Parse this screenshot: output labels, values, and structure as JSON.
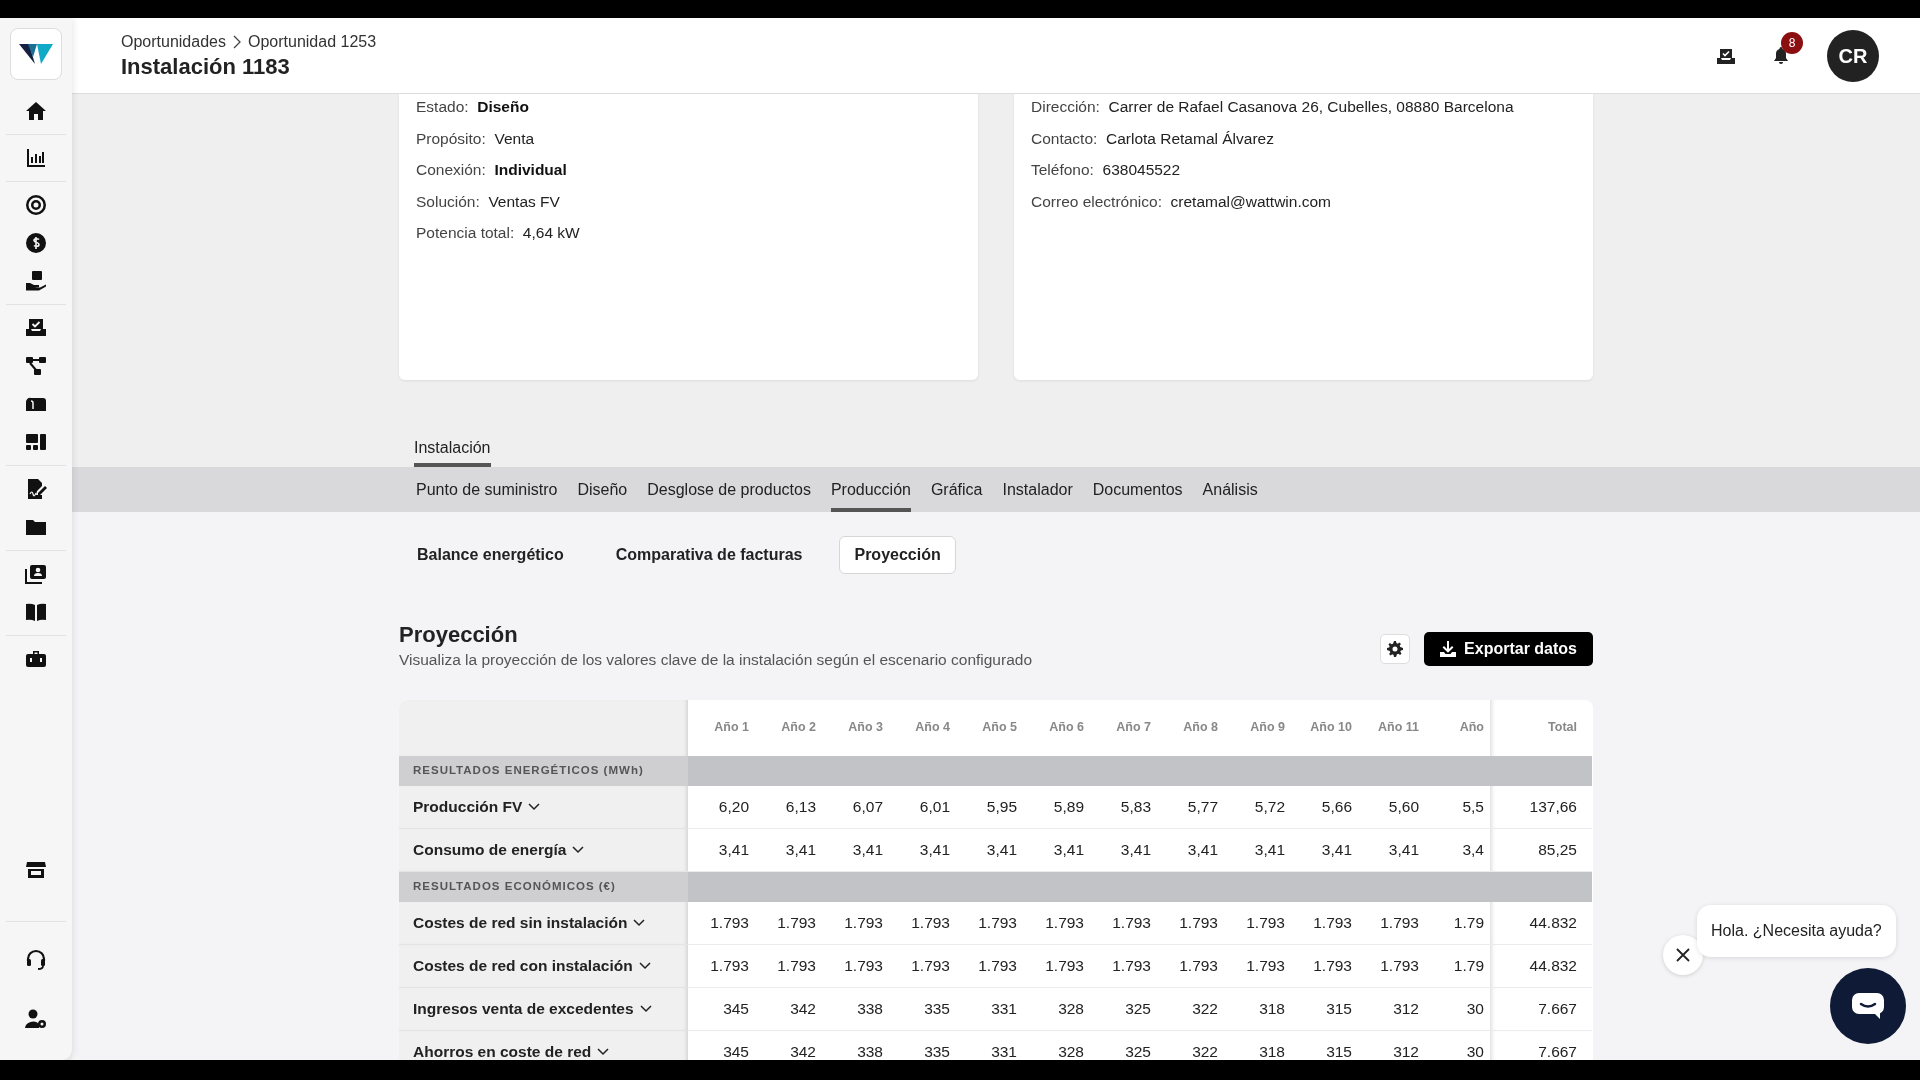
{
  "breadcrumb": [
    {
      "label": "Oportunidades"
    },
    {
      "label": "Oportunidad 1253"
    }
  ],
  "page_title": "Instalación 1183",
  "header": {
    "notification_count": "8",
    "avatar_initials": "CR"
  },
  "info_cards": [
    {
      "fields": [
        {
          "label": "Estado:",
          "value": "Diseño",
          "bold": true
        },
        {
          "label": "Propósito:",
          "value": "Venta",
          "bold": false
        },
        {
          "label": "Conexión:",
          "value": "Individual",
          "bold": true
        },
        {
          "label": "Solución:",
          "value": "Ventas FV",
          "bold": false
        },
        {
          "label": "Potencia total:",
          "value": "4,64 kW",
          "bold": false
        }
      ]
    },
    {
      "fields": [
        {
          "label": "Dirección:",
          "value": "Carrer de Rafael Casanova 26, Cubelles, 08880 Barcelona",
          "bold": false
        },
        {
          "label": "Contacto:",
          "value": "Carlota Retamal Álvarez",
          "bold": false
        },
        {
          "label": "Teléfono:",
          "value": "638045522",
          "bold": false
        },
        {
          "label": "Correo electrónico:",
          "value": "cretamal@wattwin.com",
          "bold": false
        }
      ]
    }
  ],
  "section_tabs": [
    {
      "label": "Instalación",
      "selected": true
    }
  ],
  "tabs": [
    {
      "label": "Punto de suministro",
      "selected": false
    },
    {
      "label": "Diseño",
      "selected": false
    },
    {
      "label": "Desglose de productos",
      "selected": false
    },
    {
      "label": "Producción",
      "selected": true
    },
    {
      "label": "Gráfica",
      "selected": false
    },
    {
      "label": "Instalador",
      "selected": false
    },
    {
      "label": "Documentos",
      "selected": false
    },
    {
      "label": "Análisis",
      "selected": false
    }
  ],
  "subtabs": [
    {
      "label": "Balance energético",
      "selected": false
    },
    {
      "label": "Comparativa de facturas",
      "selected": false
    },
    {
      "label": "Proyección",
      "selected": true
    }
  ],
  "projection": {
    "title": "Proyección",
    "description": "Visualiza la proyección de los valores clave de la instalación según el escenario configurado",
    "export_button": "Exportar datos"
  },
  "table": {
    "columns": [
      "Año 1",
      "Año 2",
      "Año 3",
      "Año 4",
      "Año 5",
      "Año 6",
      "Año 7",
      "Año 8",
      "Año 9",
      "Año 10",
      "Año 11",
      "Año"
    ],
    "total_column": "Total",
    "rows": [
      {
        "kind": "section",
        "label": "RESULTADOS ENERGÉTICOS (MWh)"
      },
      {
        "kind": "data",
        "label": "Producción FV",
        "values": [
          "6,20",
          "6,13",
          "6,07",
          "6,01",
          "5,95",
          "5,89",
          "5,83",
          "5,77",
          "5,72",
          "5,66",
          "5,60",
          "5,5"
        ],
        "total": "137,66"
      },
      {
        "kind": "data",
        "label": "Consumo de energía",
        "values": [
          "3,41",
          "3,41",
          "3,41",
          "3,41",
          "3,41",
          "3,41",
          "3,41",
          "3,41",
          "3,41",
          "3,41",
          "3,41",
          "3,4"
        ],
        "total": "85,25"
      },
      {
        "kind": "section",
        "label": "RESULTADOS ECONÓMICOS (€)"
      },
      {
        "kind": "data",
        "label": "Costes de red sin instalación",
        "values": [
          "1.793",
          "1.793",
          "1.793",
          "1.793",
          "1.793",
          "1.793",
          "1.793",
          "1.793",
          "1.793",
          "1.793",
          "1.793",
          "1.79"
        ],
        "total": "44.832"
      },
      {
        "kind": "data",
        "label": "Costes de red con instalación",
        "values": [
          "1.793",
          "1.793",
          "1.793",
          "1.793",
          "1.793",
          "1.793",
          "1.793",
          "1.793",
          "1.793",
          "1.793",
          "1.793",
          "1.79"
        ],
        "total": "44.832"
      },
      {
        "kind": "data",
        "label": "Ingresos venta de excedentes",
        "values": [
          "345",
          "342",
          "338",
          "335",
          "331",
          "328",
          "325",
          "322",
          "318",
          "315",
          "312",
          "30"
        ],
        "total": "7.667"
      },
      {
        "kind": "data",
        "label": "Ahorros en coste de red",
        "values": [
          "345",
          "342",
          "338",
          "335",
          "331",
          "328",
          "325",
          "322",
          "318",
          "315",
          "312",
          "30"
        ],
        "total": "7.667"
      }
    ]
  },
  "chat": {
    "greeting": "Hola. ¿Necesita ayuda?"
  }
}
